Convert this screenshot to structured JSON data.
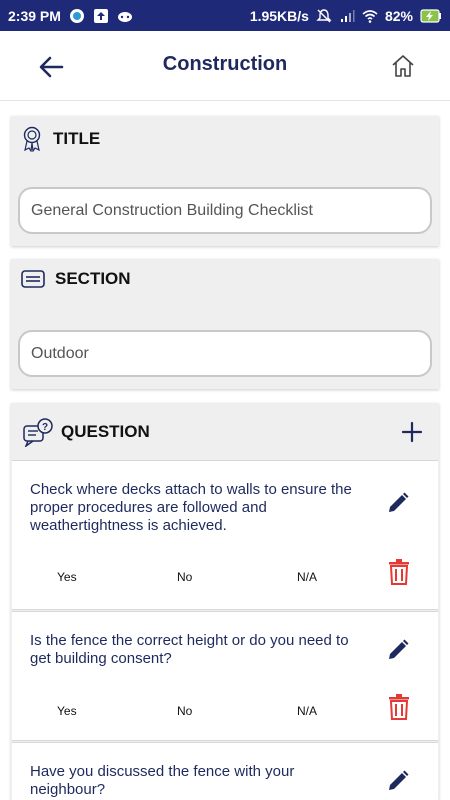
{
  "status_bar": {
    "time": "2:39 PM",
    "speed": "1.95KB/s",
    "battery": "82%"
  },
  "header": {
    "title": "Construction",
    "back_icon": "arrow-left-icon",
    "home_icon": "home-icon"
  },
  "title_section": {
    "label": "TITLE",
    "icon": "award-badge-icon",
    "value": "General Construction Building Checklist"
  },
  "section_section": {
    "label": "SECTION",
    "icon": "keyboard-icon",
    "value": "Outdoor"
  },
  "questions_section": {
    "label": "QUESTION",
    "icon": "question-chat-icon",
    "add_icon": "plus-icon",
    "items": [
      {
        "text": "Check where decks attach to walls to ensure the proper procedures are followed and weathertightness is achieved.",
        "options": [
          "Yes",
          "No",
          "N/A"
        ]
      },
      {
        "text": "Is the fence the correct height or do you need to get building consent?",
        "options": [
          "Yes",
          "No",
          "N/A"
        ]
      },
      {
        "text": "Have you discussed the fence with your neighbour?",
        "options": []
      }
    ]
  },
  "colors": {
    "status_bar": "#1e2a78",
    "primary_text": "#1e2a5e",
    "delete": "#e53935",
    "card_bg": "#efefef"
  }
}
